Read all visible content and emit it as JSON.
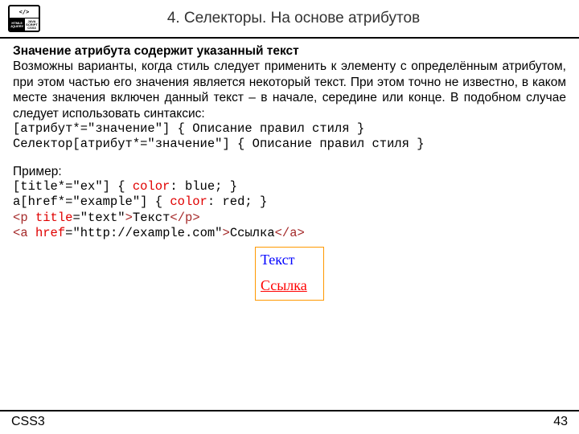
{
  "logo": {
    "top": "</>",
    "bl": "HTML5\nJQUERY",
    "br": "JAVA\nSCRIPT\nCSS3"
  },
  "header": {
    "title": "4. Селекторы. На основе атрибутов"
  },
  "body": {
    "subheading": "Значение атрибута содержит указанный текст",
    "para": "Возможны варианты, когда стиль следует применить к элементу с определённым атрибутом, при этом частью его значения является некоторый текст. При этом точно не известно, в каком месте значения включен данный текст – в начале, середине или конце. В подобном случае следует использовать синтаксис:",
    "syntax1": "[атрибут*=\"значение\"] { Описание правил стиля }",
    "syntax2": "Селектор[атрибут*=\"значение\"] { Описание правил стиля }",
    "example_label": "Пример:",
    "ex1": {
      "a": "[title*=\"ex\"] { ",
      "prop": "color",
      "b": ": blue; }"
    },
    "ex2": {
      "a": "a[href*=\"example\"] { ",
      "prop": "color",
      "b": ": red; }"
    },
    "ex3": {
      "lt1": "<",
      "tag1": "p",
      "sp": " ",
      "attr": "title",
      "eq": "=\"text\"",
      "gt": ">",
      "text": "Текст",
      "lt2": "</",
      "tag2": "p",
      "gt2": ">"
    },
    "ex4": {
      "lt1": "<",
      "tag1": "a",
      "sp": " ",
      "attr": "href",
      "eq": "=\"http://example.com\"",
      "gt": ">",
      "text": "Ссылка",
      "lt2": "</",
      "tag2": "a",
      "gt2": ">"
    },
    "result": {
      "line1": "Текст",
      "line2": "Ссылка"
    }
  },
  "footer": {
    "left": "CSS3",
    "right": "43"
  }
}
